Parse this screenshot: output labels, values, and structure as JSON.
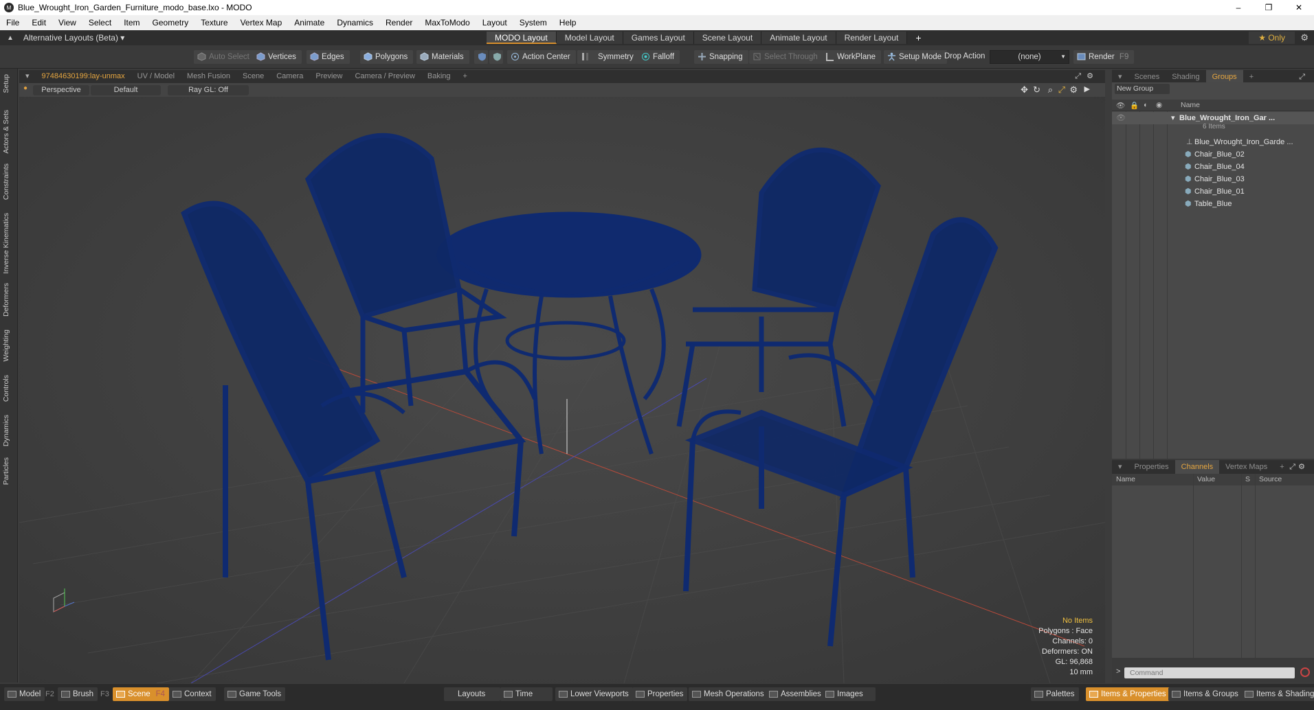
{
  "window": {
    "title": "Blue_Wrought_Iron_Garden_Furniture_modo_base.lxo - MODO",
    "app_icon": "modo-logo-icon",
    "controls": [
      "–",
      "❐",
      "✕"
    ]
  },
  "menu": [
    "File",
    "Edit",
    "View",
    "Select",
    "Item",
    "Geometry",
    "Texture",
    "Vertex Map",
    "Animate",
    "Dynamics",
    "Render",
    "MaxToModo",
    "Layout",
    "System",
    "Help"
  ],
  "layouts": {
    "alt_label": "Alternative Layouts (Beta) ▾",
    "tabs": [
      "MODO Layout",
      "Model Layout",
      "Games Layout",
      "Scene Layout",
      "Animate Layout",
      "Render Layout"
    ],
    "active_tab": "MODO Layout",
    "add": "+",
    "only_label": "★  Only"
  },
  "toolbar": {
    "auto_select": "Auto Select",
    "vertices": "Vertices",
    "edges": "Edges",
    "polygons": "Polygons",
    "materials": "Materials",
    "action_center": "Action Center",
    "symmetry": "Symmetry",
    "falloff": "Falloff",
    "snapping": "Snapping",
    "select_through": "Select Through",
    "workplane": "WorkPlane",
    "setup_mode": "Setup Mode",
    "drop_action": "Drop Action",
    "drop_value": "(none)",
    "render": "Render",
    "render_key": "F9"
  },
  "left_tabs": [
    "Setup",
    "Actors & Sets",
    "Constraints",
    "Inverse Kinematics",
    "Deformers",
    "Weighting",
    "Controls",
    "Dynamics",
    "Particles"
  ],
  "viewport_tabs": [
    "97484630199:lay-unmax",
    "UV / Model",
    "Mesh Fusion",
    "Scene",
    "Camera",
    "Preview",
    "Camera / Preview",
    "Baking",
    "+"
  ],
  "viewport": {
    "view": "Perspective",
    "shading": "Default",
    "raygl": "Ray GL: Off",
    "hud": {
      "selection": "No Items",
      "polygons": "Polygons : Face",
      "channels": "Channels: 0",
      "deformers": "Deformers: ON",
      "gl": "GL: 96,868",
      "unit": "10 mm"
    }
  },
  "scene_panel": {
    "tabs": [
      "Scenes",
      "Shading",
      "Groups",
      "+"
    ],
    "active": "Groups",
    "new_group": "New Group",
    "col_name": "Name",
    "root_name": "Blue_Wrought_Iron_Gar ...",
    "root_count": "6 Items",
    "items": [
      "Blue_Wrought_Iron_Garde ...",
      "Chair_Blue_02",
      "Chair_Blue_04",
      "Chair_Blue_03",
      "Chair_Blue_01",
      "Table_Blue"
    ]
  },
  "props_panel": {
    "tabs": [
      "Properties",
      "Channels",
      "Vertex Maps",
      "+"
    ],
    "active": "Channels",
    "cols": [
      "Name",
      "Value",
      "S",
      "Source"
    ]
  },
  "command": {
    "arrow": ">",
    "placeholder": "Command"
  },
  "bottom": {
    "model": "Model",
    "model_key": "F2",
    "brush": "Brush",
    "brush_key": "F3",
    "scene": "Scene",
    "scene_key": "F4",
    "context": "Context",
    "game_tools": "Game Tools",
    "layouts": "Layouts",
    "time": "Time",
    "lower_viewports": "Lower Viewports",
    "properties": "Properties",
    "mesh_operations": "Mesh Operations",
    "assemblies": "Assemblies",
    "images": "Images",
    "palettes": "Palettes",
    "items_properties": "Items & Properties",
    "items_groups": "Items & Groups",
    "items_shading": "Items & Shading"
  },
  "colors": {
    "accent": "#d9902c",
    "furniture": "#12307a",
    "viewport_bg": "#434343"
  }
}
